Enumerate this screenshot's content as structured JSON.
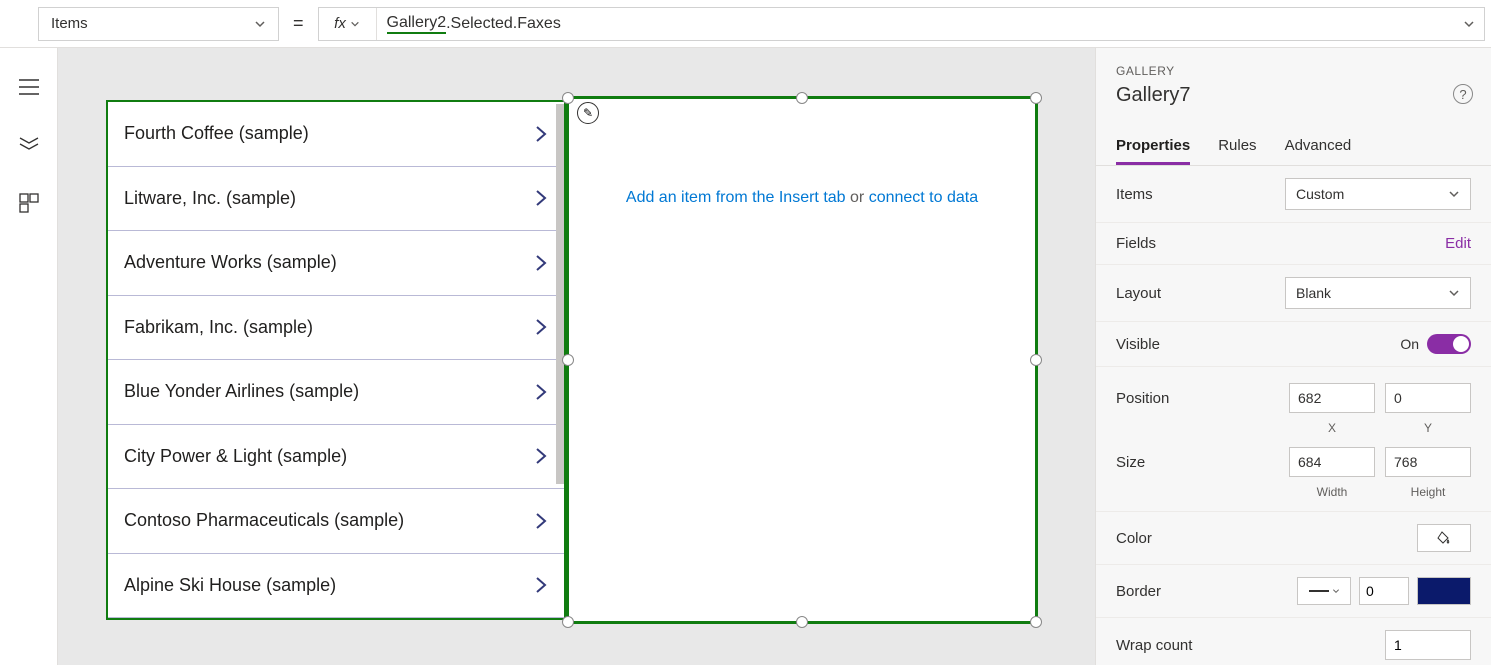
{
  "formula": {
    "property_label": "Items",
    "fx_label": "fx",
    "token": "Gallery2",
    "rest": ".Selected.Faxes",
    "equals": "="
  },
  "list_items": [
    "Fourth Coffee (sample)",
    "Litware, Inc. (sample)",
    "Adventure Works (sample)",
    "Fabrikam, Inc. (sample)",
    "Blue Yonder Airlines (sample)",
    "City Power & Light (sample)",
    "Contoso Pharmaceuticals (sample)",
    "Alpine Ski House (sample)"
  ],
  "gallery_placeholder": {
    "link1": "Add an item from the Insert tab",
    "mid": " or ",
    "link2": "connect to data"
  },
  "panel": {
    "kicker": "GALLERY",
    "title": "Gallery7",
    "tabs": {
      "properties": "Properties",
      "rules": "Rules",
      "advanced": "Advanced"
    },
    "items_label": "Items",
    "items_value": "Custom",
    "fields_label": "Fields",
    "fields_edit": "Edit",
    "layout_label": "Layout",
    "layout_value": "Blank",
    "visible_label": "Visible",
    "visible_value": "On",
    "position_label": "Position",
    "position_x": "682",
    "position_y": "0",
    "x_label": "X",
    "y_label": "Y",
    "size_label": "Size",
    "size_w": "684",
    "size_h": "768",
    "w_label": "Width",
    "h_label": "Height",
    "color_label": "Color",
    "border_label": "Border",
    "border_value": "0",
    "wrap_label": "Wrap count",
    "wrap_value": "1"
  }
}
